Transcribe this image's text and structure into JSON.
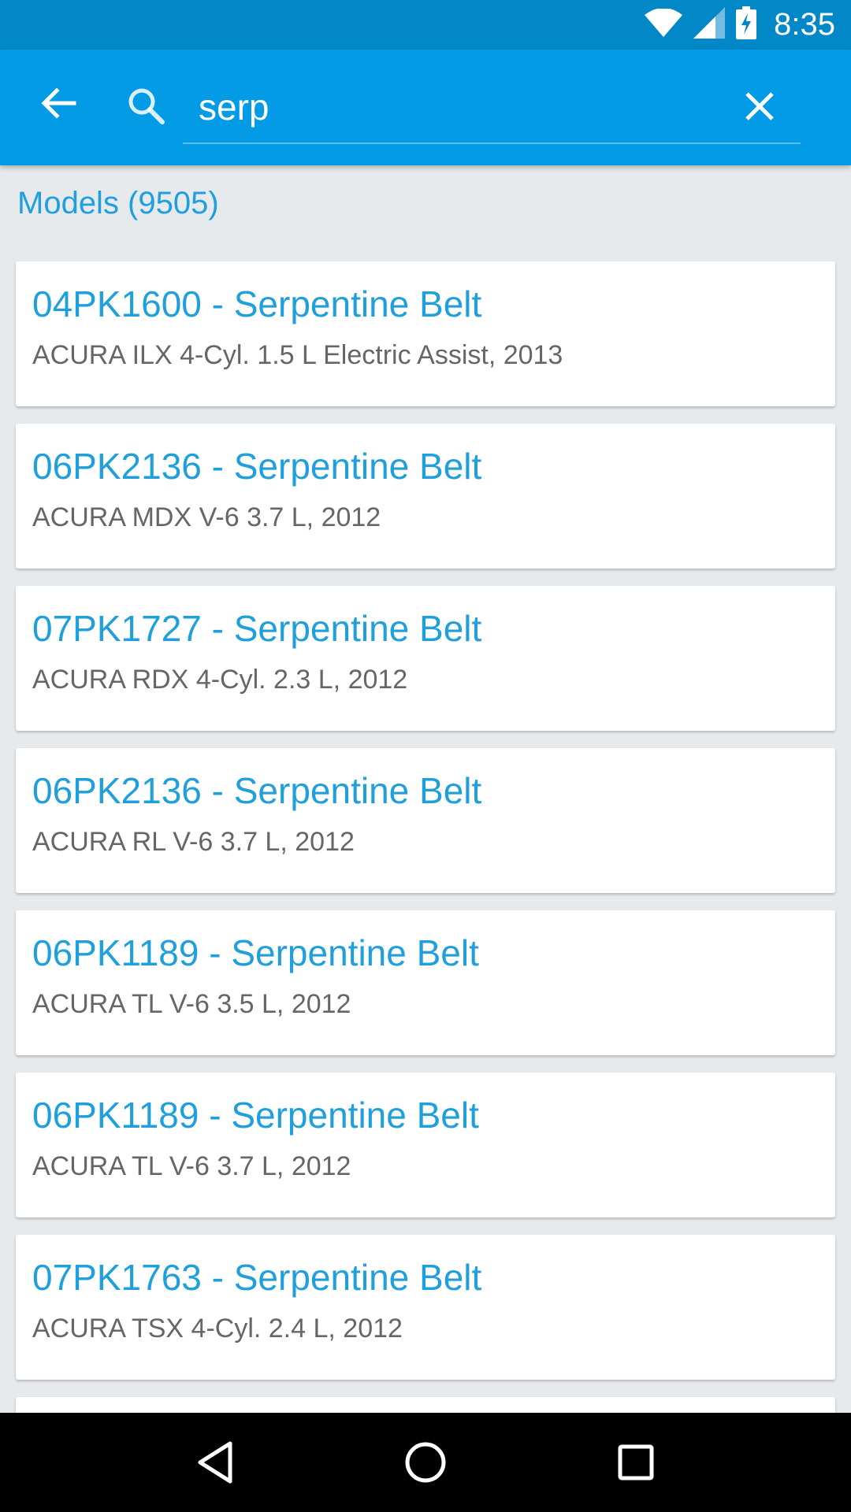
{
  "status_bar": {
    "time": "8:35",
    "icons": [
      "wifi-icon",
      "signal-icon",
      "battery-charging-icon"
    ]
  },
  "search": {
    "value": "serp",
    "placeholder": ""
  },
  "section": {
    "title": "Models (9505)"
  },
  "results": [
    {
      "title": "04PK1600 - Serpentine Belt",
      "subtitle": "ACURA ILX 4-Cyl. 1.5 L Electric Assist, 2013"
    },
    {
      "title": "06PK2136 - Serpentine Belt",
      "subtitle": "ACURA MDX V-6 3.7 L, 2012"
    },
    {
      "title": "07PK1727 - Serpentine Belt",
      "subtitle": "ACURA RDX 4-Cyl. 2.3 L, 2012"
    },
    {
      "title": "06PK2136 - Serpentine Belt",
      "subtitle": "ACURA RL V-6 3.7 L, 2012"
    },
    {
      "title": "06PK1189 - Serpentine Belt",
      "subtitle": "ACURA TL V-6 3.5 L, 2012"
    },
    {
      "title": "06PK1189 - Serpentine Belt",
      "subtitle": "ACURA TL V-6 3.7 L, 2012"
    },
    {
      "title": "07PK1763 - Serpentine Belt",
      "subtitle": "ACURA TSX 4-Cyl. 2.4 L, 2012"
    }
  ],
  "colors": {
    "status_bar": "#0288c7",
    "app_bar": "#039be5",
    "accent_text": "#1f9fdc",
    "background": "#e7eaed"
  },
  "nav_bar": {
    "buttons": [
      "back-triangle-icon",
      "home-circle-icon",
      "recents-square-icon"
    ]
  }
}
